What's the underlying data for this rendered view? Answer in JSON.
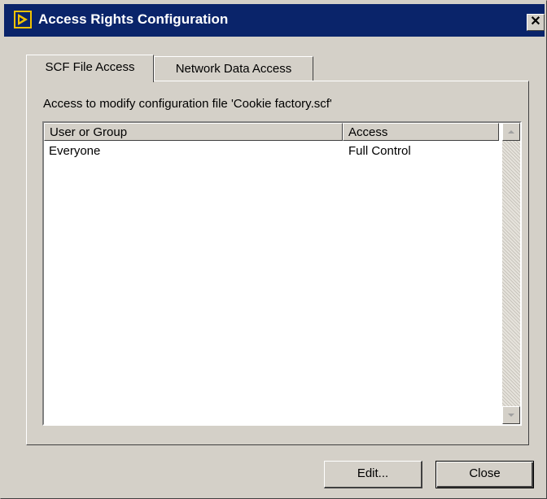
{
  "window": {
    "title": "Access Rights Configuration",
    "close_glyph": "✕",
    "icon": "labview-icon"
  },
  "tabs": [
    {
      "label": "SCF File Access",
      "selected": true
    },
    {
      "label": "Network Data Access",
      "selected": false
    }
  ],
  "panel": {
    "caption": "Access to modify configuration file 'Cookie factory.scf'",
    "columns": [
      "User or Group",
      "Access"
    ],
    "rows": [
      {
        "user": "Everyone",
        "access": "Full Control"
      }
    ]
  },
  "buttons": {
    "edit_label": "Edit...",
    "close_label": "Close"
  },
  "colors": {
    "titlebar": "#0a246a",
    "face": "#d4d0c8"
  }
}
